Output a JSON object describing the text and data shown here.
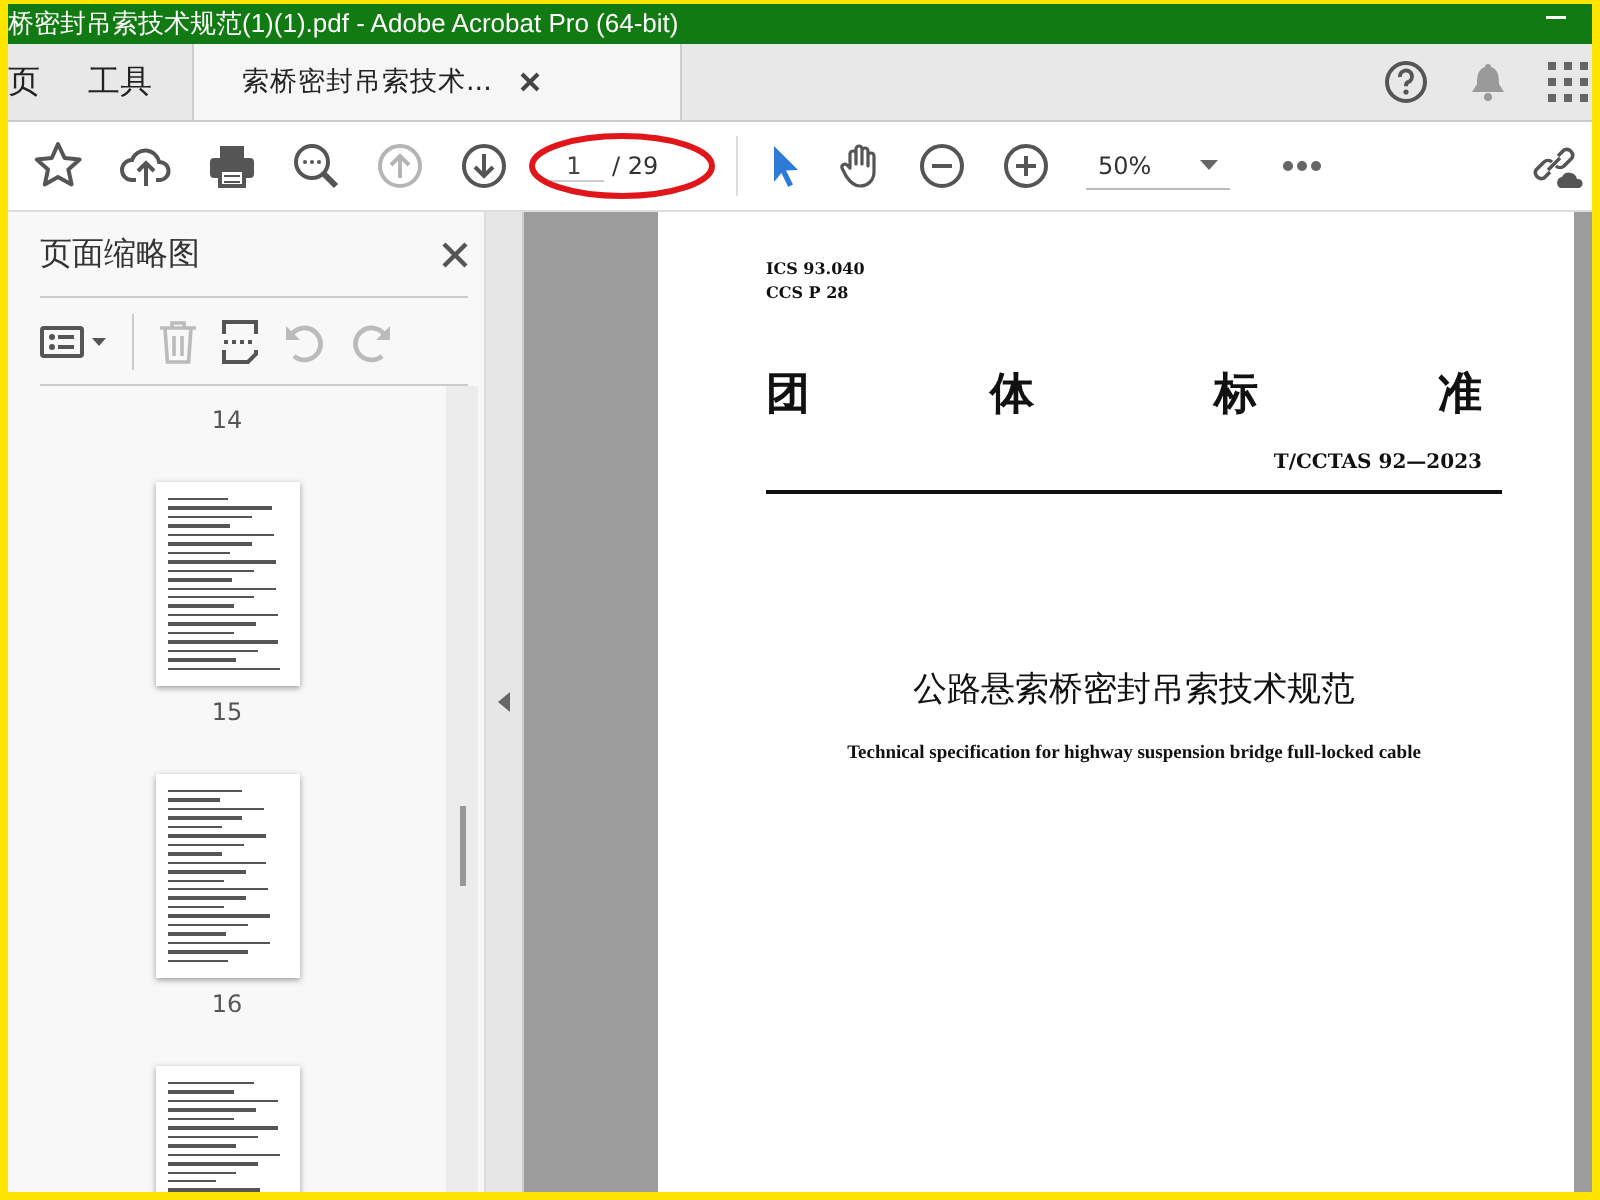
{
  "window": {
    "title": "桥密封吊索技术规范(1)(1).pdf - Adobe Acrobat Pro (64-bit)"
  },
  "tabs": [
    {
      "label": "页",
      "selected": false
    },
    {
      "label": "工具",
      "selected": false
    },
    {
      "label": "索桥密封吊索技术...",
      "selected": true
    }
  ],
  "toolbar": {
    "page_number": "1",
    "page_total": "/ 29",
    "zoom": "50%",
    "previous_disabled": true
  },
  "sidebar": {
    "title": "页面缩略图",
    "thumbnails": [
      {
        "kind": "label",
        "label": "14"
      },
      {
        "kind": "page",
        "label": "15"
      },
      {
        "kind": "page",
        "label": "16"
      },
      {
        "kind": "page"
      }
    ]
  },
  "document": {
    "ics": "ICS 93.040",
    "ccs": "CCS P 28",
    "heading_chars": [
      "团",
      "体",
      "标",
      "准"
    ],
    "code": "T/CCTAS 92—2023",
    "title": "公路悬索桥密封吊索技术规范",
    "subtitle": "Technical specification for highway suspension bridge full-locked cable"
  }
}
